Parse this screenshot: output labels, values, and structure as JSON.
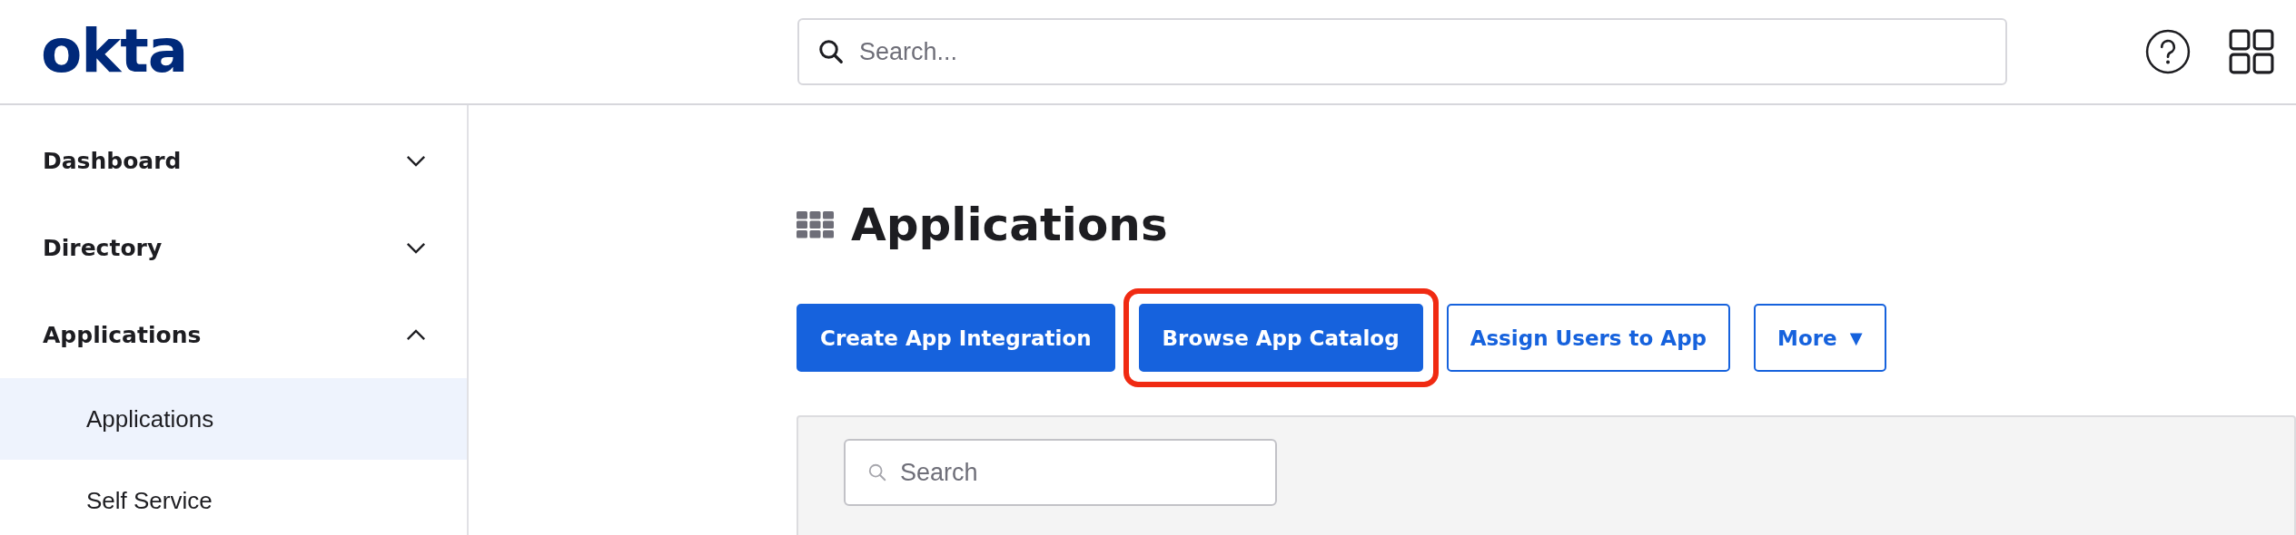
{
  "header": {
    "logo": "okta",
    "search": {
      "placeholder": "Search..."
    }
  },
  "sidebar": {
    "items": [
      {
        "label": "Dashboard",
        "expanded": false
      },
      {
        "label": "Directory",
        "expanded": false
      },
      {
        "label": "Applications",
        "expanded": true,
        "children": [
          {
            "label": "Applications",
            "selected": true
          },
          {
            "label": "Self Service",
            "selected": false
          }
        ]
      }
    ]
  },
  "page": {
    "title": "Applications",
    "buttons": [
      {
        "label": "Create App Integration",
        "kind": "primary",
        "highlighted": false
      },
      {
        "label": "Browse App Catalog",
        "kind": "primary",
        "highlighted": true
      },
      {
        "label": "Assign Users to App",
        "kind": "secondary",
        "highlighted": false
      },
      {
        "label": "More",
        "kind": "secondary",
        "highlighted": false,
        "caret": "▼"
      }
    ],
    "panel": {
      "search": {
        "placeholder": "Search"
      }
    }
  }
}
